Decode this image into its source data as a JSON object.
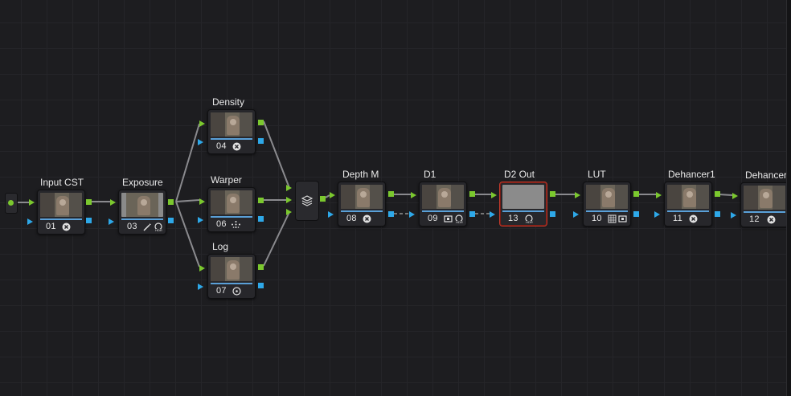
{
  "source": {
    "name": "source-input"
  },
  "nodes": [
    {
      "id": "01",
      "label": "Input CST",
      "icons": [
        "fx-icon"
      ]
    },
    {
      "id": "03",
      "label": "Exposure",
      "icons": [
        "wand-icon",
        "hdr-icon"
      ]
    },
    {
      "id": "04",
      "label": "Density",
      "icons": [
        "fx-icon"
      ]
    },
    {
      "id": "06",
      "label": "Warper",
      "icons": [
        "warper-icon"
      ]
    },
    {
      "id": "07",
      "label": "Log",
      "icons": [
        "log-wheel-icon"
      ]
    },
    {
      "id": "08",
      "label": "Depth M",
      "icons": [
        "fx-icon"
      ]
    },
    {
      "id": "09",
      "label": "D1",
      "icons": [
        "sizing-icon",
        "hdr-icon"
      ]
    },
    {
      "id": "13",
      "label": "D2 Out",
      "icons": [
        "hdr-icon"
      ]
    },
    {
      "id": "10",
      "label": "LUT",
      "icons": [
        "lut-grid-icon",
        "sizing-icon"
      ]
    },
    {
      "id": "11",
      "label": "Dehancer1",
      "icons": [
        "fx-icon"
      ]
    },
    {
      "id": "12",
      "label": "Dehancer",
      "icons": [
        "fx-icon"
      ]
    }
  ],
  "mixer": {
    "icon": "layer-mixer-icon"
  },
  "colors": {
    "rgb_port": "#7bc82e",
    "alpha_port": "#2ea8e8",
    "selected_outline": "#c0392b",
    "background": "#1d1d20"
  }
}
